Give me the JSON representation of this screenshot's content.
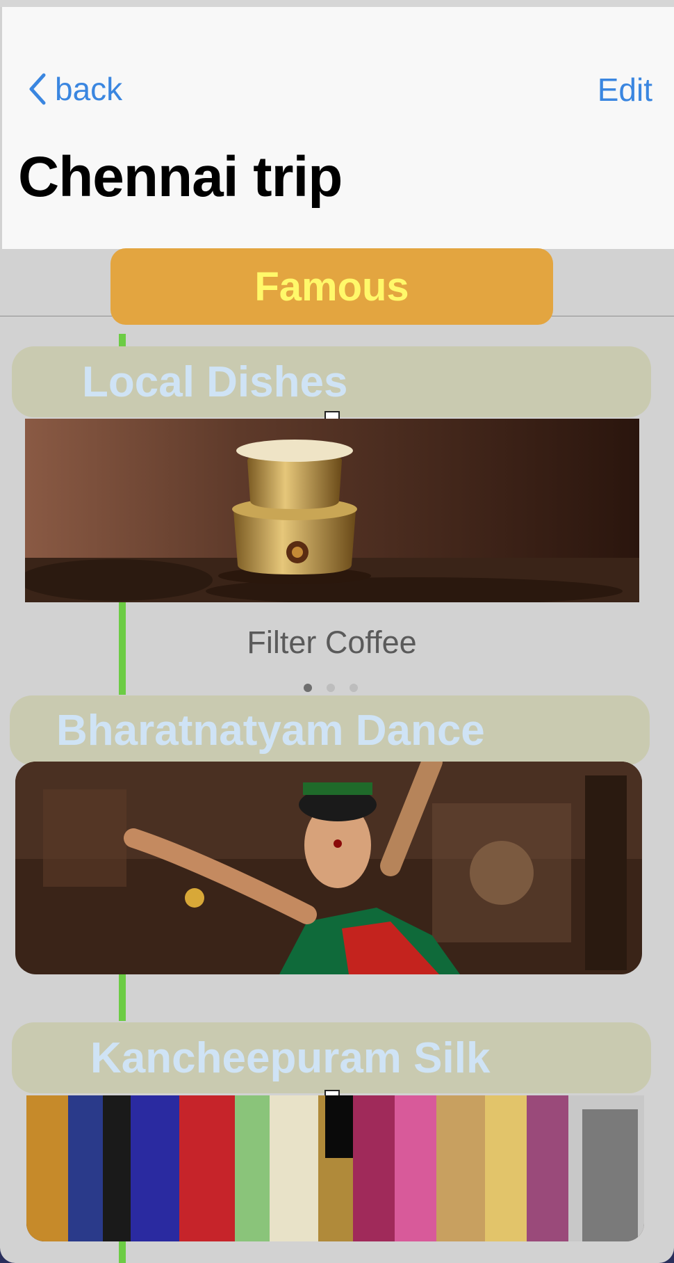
{
  "nav": {
    "back_label": "back",
    "edit_label": "Edit",
    "title": "Chennai trip"
  },
  "segment": {
    "label": "Famous"
  },
  "sections": [
    {
      "title": "Local Dishes",
      "caption": "Filter Coffee",
      "page_count": 3,
      "active_page": 1
    },
    {
      "title": "Bharatnatyam Dance"
    },
    {
      "title": "Kancheepuram Silk"
    }
  ],
  "colors": {
    "accent": "#3a86e0",
    "segment_bg": "#e3a540",
    "segment_text": "#fff86a",
    "section_bg": "#c9cab0",
    "section_text": "#cfe3f5",
    "guide_line": "#6ccc44"
  }
}
